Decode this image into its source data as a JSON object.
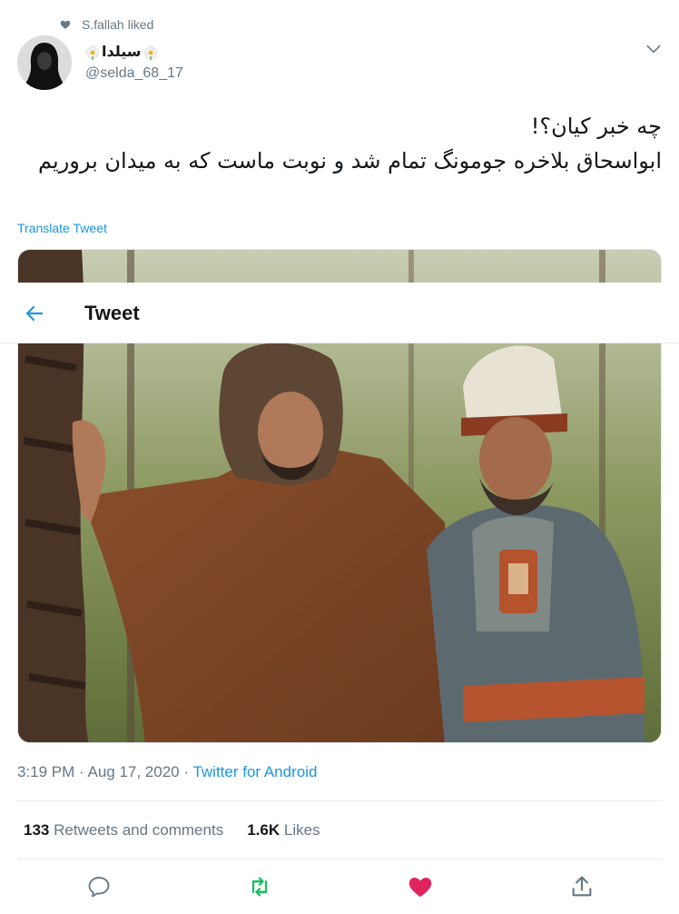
{
  "social_context": {
    "text": "S.fallah liked",
    "icon": "heart-icon"
  },
  "author": {
    "display_name": "سیلدا",
    "handle": "@selda_68_17",
    "emoji": "flower-emoji"
  },
  "tweet": {
    "line1": "چه خبر کیان؟!",
    "line2": "ابواسحاق بلاخره جومونگ تمام شد و نوبت ماست که به میدان بروریم",
    "translate_label": "Translate Tweet"
  },
  "header": {
    "title": "Tweet",
    "back_icon": "back-arrow-icon"
  },
  "meta": {
    "time_date": "3:19 PM · Aug 17, 2020 · ",
    "source": "Twitter for Android"
  },
  "stats": {
    "retweets_count": "133",
    "retweets_label": "Retweets and comments",
    "likes_count": "1.6K",
    "likes_label": "Likes"
  },
  "colors": {
    "accent": "#1b95e0",
    "retweet": "#17bf63",
    "like": "#e0245e",
    "muted": "#657786"
  }
}
